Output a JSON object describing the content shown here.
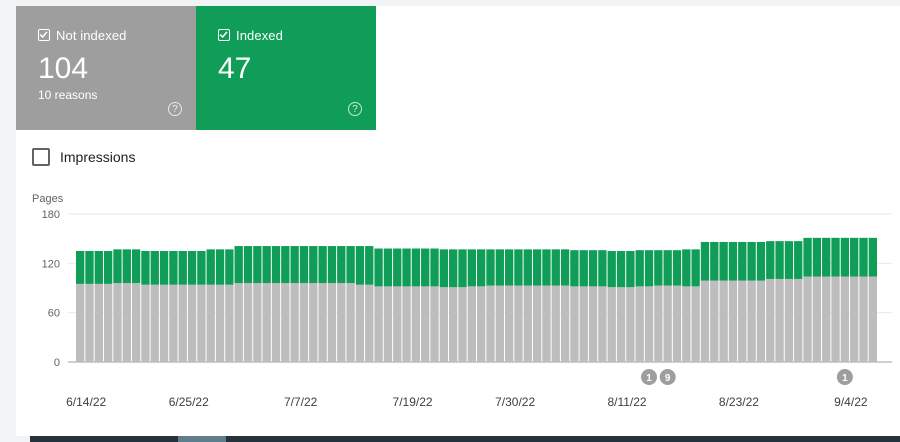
{
  "tiles": {
    "not_indexed": {
      "label": "Not indexed",
      "value": "104",
      "sub": "10 reasons",
      "help": "?"
    },
    "indexed": {
      "label": "Indexed",
      "value": "47",
      "help": "?"
    }
  },
  "impressions": {
    "label": "Impressions"
  },
  "colors": {
    "not_indexed": "#bdbdbd",
    "indexed": "#0f9d58",
    "annotation": "#9e9e9e"
  },
  "chart_data": {
    "type": "bar",
    "stacked": true,
    "ylabel": "Pages",
    "yticks": [
      0,
      60,
      120,
      180
    ],
    "ylim": [
      0,
      180
    ],
    "grid": true,
    "xtick_labels": [
      "6/14/22",
      "6/25/22",
      "7/7/22",
      "7/19/22",
      "7/30/22",
      "8/11/22",
      "8/23/22",
      "9/4/22"
    ],
    "xtick_indices": [
      0,
      11,
      23,
      35,
      46,
      58,
      70,
      82
    ],
    "annotations": [
      {
        "index": 61,
        "label": "1"
      },
      {
        "index": 63,
        "label": "9"
      },
      {
        "index": 82,
        "label": "1"
      }
    ],
    "series": [
      {
        "name": "Not indexed",
        "values": [
          95,
          95,
          95,
          95,
          96,
          96,
          96,
          94,
          94,
          94,
          94,
          94,
          94,
          94,
          94,
          94,
          94,
          96,
          96,
          96,
          96,
          96,
          96,
          96,
          96,
          96,
          96,
          96,
          96,
          96,
          94,
          94,
          92,
          92,
          92,
          92,
          92,
          92,
          92,
          91,
          91,
          91,
          92,
          92,
          93,
          93,
          93,
          93,
          93,
          93,
          93,
          93,
          93,
          92,
          92,
          92,
          92,
          91,
          91,
          91,
          92,
          92,
          93,
          93,
          93,
          92,
          92,
          99,
          99,
          99,
          99,
          99,
          99,
          99,
          101,
          101,
          101,
          101,
          104,
          104,
          104,
          104,
          104,
          104,
          104,
          104
        ]
      },
      {
        "name": "Indexed",
        "values": [
          40,
          40,
          40,
          40,
          41,
          41,
          41,
          41,
          41,
          41,
          41,
          41,
          41,
          41,
          43,
          43,
          43,
          45,
          45,
          45,
          45,
          45,
          45,
          45,
          45,
          45,
          45,
          45,
          45,
          45,
          47,
          47,
          46,
          46,
          46,
          46,
          46,
          46,
          46,
          46,
          46,
          46,
          45,
          45,
          44,
          44,
          44,
          44,
          44,
          44,
          44,
          44,
          44,
          44,
          44,
          44,
          44,
          44,
          44,
          44,
          44,
          44,
          43,
          43,
          43,
          45,
          45,
          47,
          47,
          47,
          47,
          47,
          47,
          47,
          46,
          46,
          46,
          46,
          47,
          47,
          47,
          47,
          47,
          47,
          47,
          47
        ]
      }
    ]
  }
}
